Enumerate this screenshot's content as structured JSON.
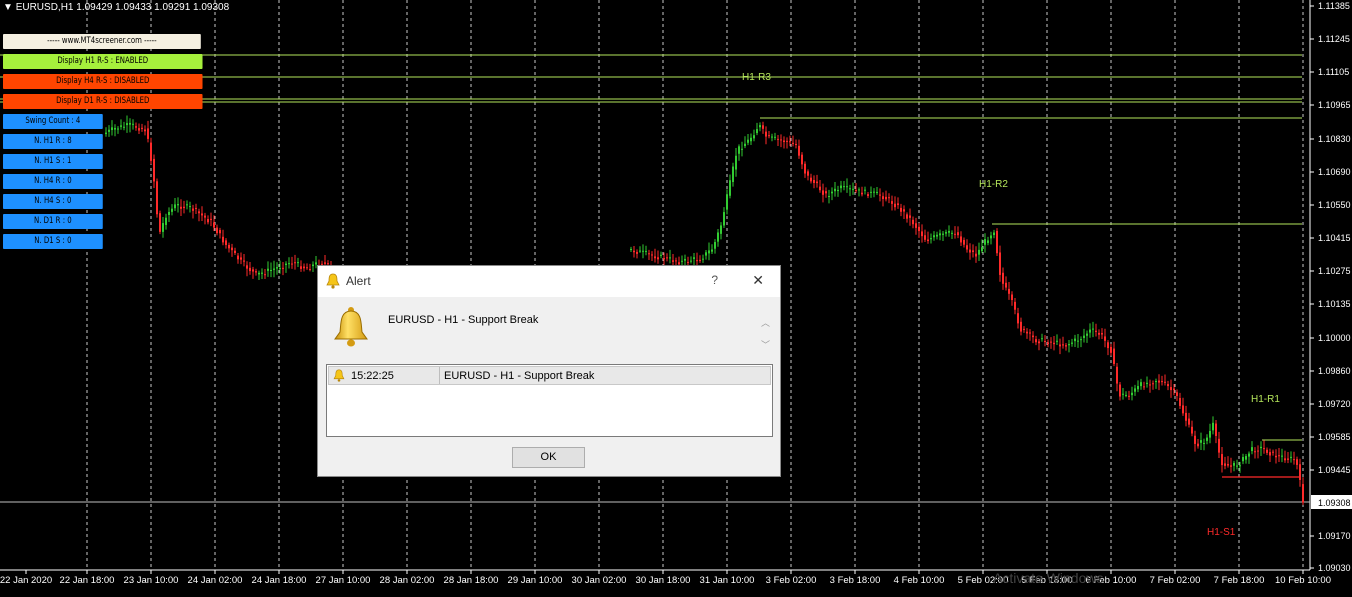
{
  "header": {
    "symbol_line": "EURUSD,H1  1.09429 1.09433 1.09291 1.09308"
  },
  "panel": {
    "site": "----- www.MT4screener.com -----",
    "h1_toggle": "Display H1 R-S : ENABLED",
    "h4_toggle": "Display H4 R-S : DISABLED",
    "d1_toggle": "Display D1 R-S : DISABLED",
    "swing_count": "Swing Count : 4",
    "n_h1_r": "N. H1 R : 8",
    "n_h1_s": "N. H1 S : 1",
    "n_h4_r": "N. H4 R : 0",
    "n_h4_s": "N. H4 S : 0",
    "n_d1_r": "N. D1 R : 0",
    "n_d1_s": "N. D1 S : 0"
  },
  "colors": {
    "enabled": "#a6f03c",
    "disabled": "#ff4500",
    "info": "#1e90ff",
    "bull": "#32cd32",
    "bear": "#ff2a2a",
    "level": "#b5e65b",
    "support": "#ff2a2a",
    "grid": "#c8c8c8"
  },
  "levels": {
    "h1_r3": "H1-R3",
    "h1_r2": "H1-R2",
    "h1_r1": "H1-R1",
    "h1_s1": "H1-S1"
  },
  "price_axis": [
    "1.11385",
    "1.11245",
    "1.11105",
    "1.10965",
    "1.10830",
    "1.10690",
    "1.10550",
    "1.10415",
    "1.10275",
    "1.10135",
    "1.10000",
    "1.09860",
    "1.09720",
    "1.09585",
    "1.09445",
    "1.09170",
    "1.09030"
  ],
  "current_price": "1.09308",
  "time_axis": [
    "22 Jan 2020",
    "22 Jan 18:00",
    "23 Jan 10:00",
    "24 Jan 02:00",
    "24 Jan 18:00",
    "27 Jan 10:00",
    "28 Jan 02:00",
    "28 Jan 18:00",
    "29 Jan 10:00",
    "30 Jan 02:00",
    "30 Jan 18:00",
    "31 Jan 10:00",
    "3 Feb 02:00",
    "3 Feb 18:00",
    "4 Feb 10:00",
    "5 Feb 02:00",
    "5 Feb 18:00",
    "6 Feb 10:00",
    "7 Feb 02:00",
    "7 Feb 18:00",
    "10 Feb 10:00"
  ],
  "dialog": {
    "title": "Alert",
    "help": "?",
    "close": "✕",
    "message": "EURUSD - H1 -  Support Break",
    "entry_time": "15:22:25",
    "entry_text": "EURUSD - H1 -  Support Break",
    "ok_label": "OK"
  },
  "watermark": "Activate Windows"
}
